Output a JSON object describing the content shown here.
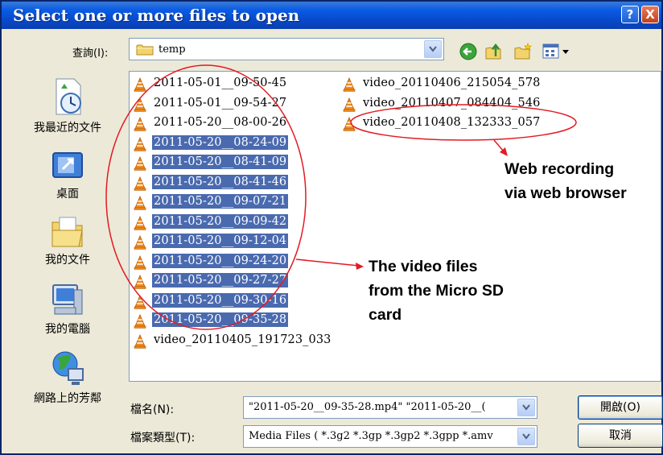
{
  "dialog": {
    "title": "Select one or more files to open",
    "help_glyph": "?",
    "close_glyph": "X"
  },
  "lookin": {
    "label": "查詢(I):",
    "value": "temp"
  },
  "toolbar": {
    "icons": [
      "back-icon",
      "up-folder-icon",
      "new-folder-icon",
      "view-menu-icon"
    ]
  },
  "places": [
    {
      "label": "我最近的文件",
      "icon": "recent-documents-icon"
    },
    {
      "label": "桌面",
      "icon": "desktop-icon"
    },
    {
      "label": "我的文件",
      "icon": "my-documents-icon"
    },
    {
      "label": "我的電腦",
      "icon": "my-computer-icon"
    },
    {
      "label": "網路上的芳鄰",
      "icon": "network-places-icon"
    }
  ],
  "files_col1": [
    {
      "name": "2011-05-01__09-50-45",
      "selected": false
    },
    {
      "name": "2011-05-01__09-54-27",
      "selected": false
    },
    {
      "name": "2011-05-20__08-00-26",
      "selected": false
    },
    {
      "name": "2011-05-20__08-24-09",
      "selected": true
    },
    {
      "name": "2011-05-20__08-41-09",
      "selected": true
    },
    {
      "name": "2011-05-20__08-41-46",
      "selected": true
    },
    {
      "name": "2011-05-20__09-07-21",
      "selected": true
    },
    {
      "name": "2011-05-20__09-09-42",
      "selected": true
    },
    {
      "name": "2011-05-20__09-12-04",
      "selected": true
    },
    {
      "name": "2011-05-20__09-24-20",
      "selected": true
    },
    {
      "name": "2011-05-20__09-27-27",
      "selected": true
    },
    {
      "name": "2011-05-20__09-30-16",
      "selected": true
    },
    {
      "name": "2011-05-20__09-35-28",
      "selected": true
    },
    {
      "name": "video_20110405_191723_033",
      "selected": false
    }
  ],
  "files_col2": [
    {
      "name": "video_20110406_215054_578",
      "selected": false
    },
    {
      "name": "video_20110407_084404_546",
      "selected": false
    },
    {
      "name": "video_20110408_132333_057",
      "selected": false
    }
  ],
  "annotations": {
    "web_line1": "Web recording",
    "web_line2": "via web browser",
    "sd_line1": "The video files",
    "sd_line2": "from the Micro SD",
    "sd_line3": "card",
    "color": "#e21b23"
  },
  "filename": {
    "label": "檔名(N):",
    "value": "\"2011-05-20__09-35-28.mp4\" \"2011-05-20__("
  },
  "filetype": {
    "label": "檔案類型(T):",
    "value": "Media Files ( *.3g2 *.3gp *.3gp2 *.3gpp *.amv"
  },
  "buttons": {
    "open": "開啟(O)",
    "cancel": "取消"
  }
}
